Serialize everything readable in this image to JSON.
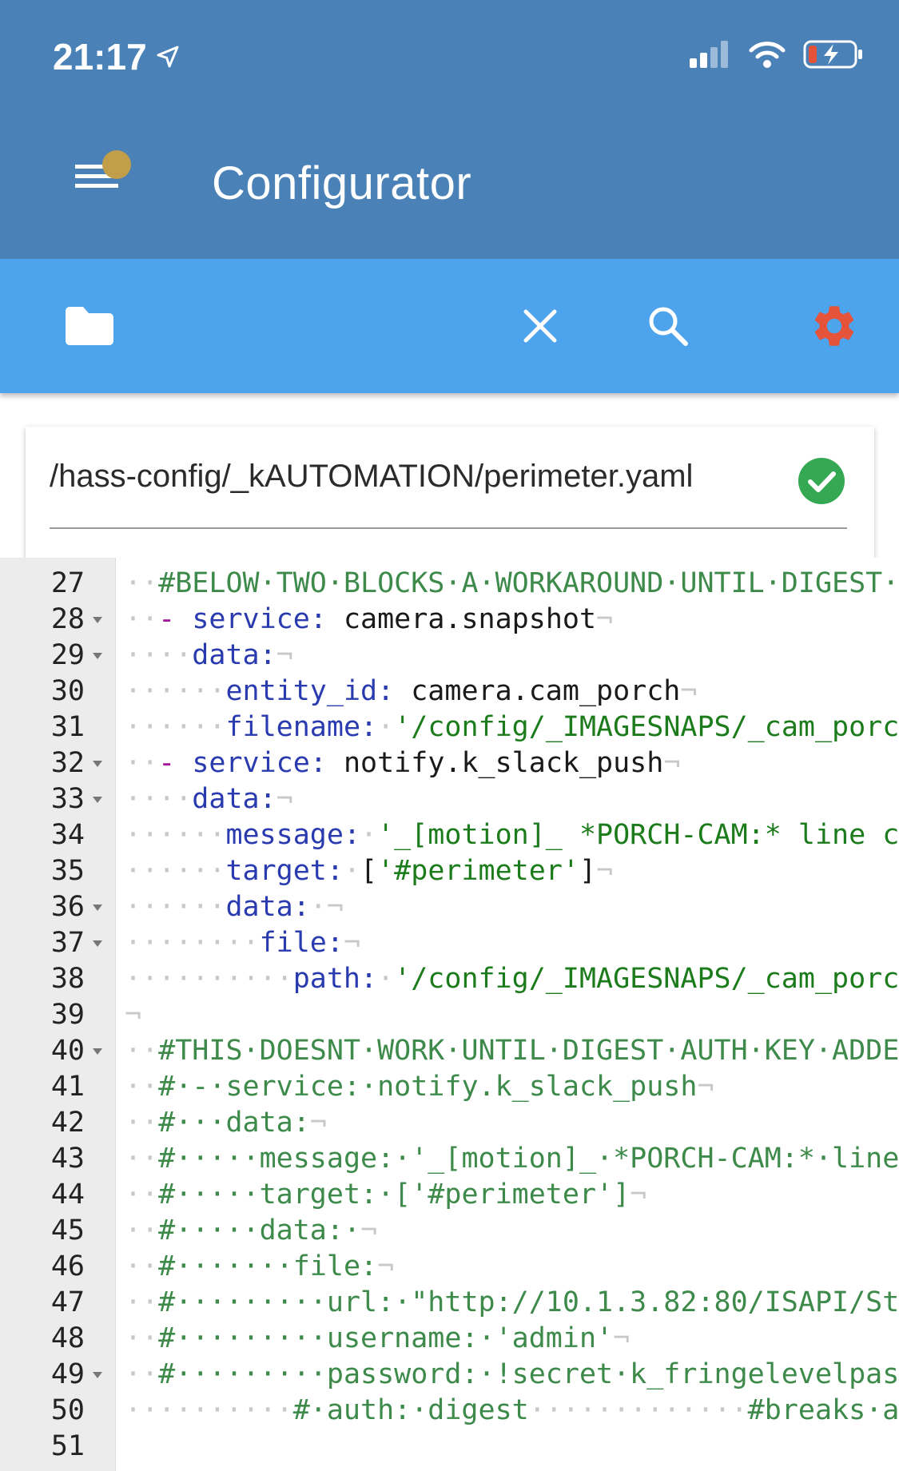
{
  "status_bar": {
    "time": "21:17"
  },
  "header": {
    "title": "Configurator"
  },
  "file": {
    "path": "/hass-config/_kAUTOMATION/perimeter.yaml"
  },
  "editor": {
    "lines": [
      {
        "n": "27",
        "fold": false,
        "segs": [
          {
            "c": "c-dot",
            "t": "··"
          },
          {
            "c": "c-comment",
            "t": "#BELOW·TWO·BLOCKS·A·WORKAROUND·UNTIL·DIGEST·"
          }
        ]
      },
      {
        "n": "28",
        "fold": true,
        "segs": [
          {
            "c": "c-dot",
            "t": "··"
          },
          {
            "c": "c-dash",
            "t": "-"
          },
          {
            "c": "c-plain",
            "t": " "
          },
          {
            "c": "c-key",
            "t": "service:"
          },
          {
            "c": "c-plain",
            "t": " camera.snapshot"
          },
          {
            "c": "c-dot",
            "t": "¬"
          }
        ]
      },
      {
        "n": "29",
        "fold": true,
        "segs": [
          {
            "c": "c-dot",
            "t": "····"
          },
          {
            "c": "c-key",
            "t": "data:"
          },
          {
            "c": "c-dot",
            "t": "¬"
          }
        ]
      },
      {
        "n": "30",
        "fold": false,
        "segs": [
          {
            "c": "c-dot",
            "t": "······"
          },
          {
            "c": "c-key",
            "t": "entity_id:"
          },
          {
            "c": "c-plain",
            "t": " camera.cam_porch"
          },
          {
            "c": "c-dot",
            "t": "¬"
          }
        ]
      },
      {
        "n": "31",
        "fold": false,
        "segs": [
          {
            "c": "c-dot",
            "t": "······"
          },
          {
            "c": "c-key",
            "t": "filename:"
          },
          {
            "c": "c-dot",
            "t": "·"
          },
          {
            "c": "c-str",
            "t": "'/config/_IMAGESNAPS/_cam_porc"
          }
        ]
      },
      {
        "n": "32",
        "fold": true,
        "segs": [
          {
            "c": "c-dot",
            "t": "··"
          },
          {
            "c": "c-dash",
            "t": "-"
          },
          {
            "c": "c-plain",
            "t": " "
          },
          {
            "c": "c-key",
            "t": "service:"
          },
          {
            "c": "c-plain",
            "t": " notify.k_slack_push"
          },
          {
            "c": "c-dot",
            "t": "¬"
          }
        ]
      },
      {
        "n": "33",
        "fold": true,
        "segs": [
          {
            "c": "c-dot",
            "t": "····"
          },
          {
            "c": "c-key",
            "t": "data:"
          },
          {
            "c": "c-dot",
            "t": "¬"
          }
        ]
      },
      {
        "n": "34",
        "fold": false,
        "segs": [
          {
            "c": "c-dot",
            "t": "······"
          },
          {
            "c": "c-key",
            "t": "message:"
          },
          {
            "c": "c-dot",
            "t": "·"
          },
          {
            "c": "c-str",
            "t": "'_[motion]_ *PORCH-CAM:* line c"
          }
        ]
      },
      {
        "n": "35",
        "fold": false,
        "segs": [
          {
            "c": "c-dot",
            "t": "······"
          },
          {
            "c": "c-key",
            "t": "target:"
          },
          {
            "c": "c-dot",
            "t": "·"
          },
          {
            "c": "c-plain",
            "t": "["
          },
          {
            "c": "c-str",
            "t": "'#perimeter'"
          },
          {
            "c": "c-plain",
            "t": "]"
          },
          {
            "c": "c-dot",
            "t": "¬"
          }
        ]
      },
      {
        "n": "36",
        "fold": true,
        "segs": [
          {
            "c": "c-dot",
            "t": "······"
          },
          {
            "c": "c-key",
            "t": "data:"
          },
          {
            "c": "c-dot",
            "t": "·¬"
          }
        ]
      },
      {
        "n": "37",
        "fold": true,
        "segs": [
          {
            "c": "c-dot",
            "t": "········"
          },
          {
            "c": "c-key",
            "t": "file:"
          },
          {
            "c": "c-dot",
            "t": "¬"
          }
        ]
      },
      {
        "n": "38",
        "fold": false,
        "segs": [
          {
            "c": "c-dot",
            "t": "··········"
          },
          {
            "c": "c-key",
            "t": "path:"
          },
          {
            "c": "c-dot",
            "t": "·"
          },
          {
            "c": "c-str",
            "t": "'/config/_IMAGESNAPS/_cam_porc"
          }
        ]
      },
      {
        "n": "39",
        "fold": false,
        "segs": [
          {
            "c": "c-dot",
            "t": "¬"
          }
        ]
      },
      {
        "n": "40",
        "fold": true,
        "segs": [
          {
            "c": "c-dot",
            "t": "··"
          },
          {
            "c": "c-comment",
            "t": "#THIS·DOESNT·WORK·UNTIL·DIGEST·AUTH·KEY·ADDE"
          }
        ]
      },
      {
        "n": "41",
        "fold": false,
        "segs": [
          {
            "c": "c-dot",
            "t": "··"
          },
          {
            "c": "c-comment",
            "t": "#·-·service:·notify.k_slack_push"
          },
          {
            "c": "c-dot",
            "t": "¬"
          }
        ]
      },
      {
        "n": "42",
        "fold": false,
        "segs": [
          {
            "c": "c-dot",
            "t": "··"
          },
          {
            "c": "c-comment",
            "t": "#···data:"
          },
          {
            "c": "c-dot",
            "t": "¬"
          }
        ]
      },
      {
        "n": "43",
        "fold": false,
        "segs": [
          {
            "c": "c-dot",
            "t": "··"
          },
          {
            "c": "c-comment",
            "t": "#·····message:·'_[motion]_·*PORCH-CAM:*·line"
          }
        ]
      },
      {
        "n": "44",
        "fold": false,
        "segs": [
          {
            "c": "c-dot",
            "t": "··"
          },
          {
            "c": "c-comment",
            "t": "#·····target:·['#perimeter']"
          },
          {
            "c": "c-dot",
            "t": "¬"
          }
        ]
      },
      {
        "n": "45",
        "fold": false,
        "segs": [
          {
            "c": "c-dot",
            "t": "··"
          },
          {
            "c": "c-comment",
            "t": "#·····data:·"
          },
          {
            "c": "c-dot",
            "t": "¬"
          }
        ]
      },
      {
        "n": "46",
        "fold": false,
        "segs": [
          {
            "c": "c-dot",
            "t": "··"
          },
          {
            "c": "c-comment",
            "t": "#·······file:"
          },
          {
            "c": "c-dot",
            "t": "¬"
          }
        ]
      },
      {
        "n": "47",
        "fold": false,
        "segs": [
          {
            "c": "c-dot",
            "t": "··"
          },
          {
            "c": "c-comment",
            "t": "#·········url:·\"http://10.1.3.82:80/ISAPI/St"
          }
        ]
      },
      {
        "n": "48",
        "fold": false,
        "segs": [
          {
            "c": "c-dot",
            "t": "··"
          },
          {
            "c": "c-comment",
            "t": "#·········username:·'admin'"
          },
          {
            "c": "c-dot",
            "t": "¬"
          }
        ]
      },
      {
        "n": "49",
        "fold": true,
        "segs": [
          {
            "c": "c-dot",
            "t": "··"
          },
          {
            "c": "c-comment",
            "t": "#·········password:·!secret·k_fringelevelpas"
          }
        ]
      },
      {
        "n": "50",
        "fold": false,
        "segs": [
          {
            "c": "c-dot",
            "t": "··········"
          },
          {
            "c": "c-comment",
            "t": "#·auth:·digest"
          },
          {
            "c": "c-dot",
            "t": "·············"
          },
          {
            "c": "c-comment",
            "t": "#breaks·af"
          }
        ]
      },
      {
        "n": "51",
        "fold": false,
        "segs": []
      }
    ]
  },
  "colors": {
    "header_bg": "#4a82b8",
    "toolbar_bg": "#4da4ec",
    "settings_icon": "#e5533b",
    "success_icon": "#34a853",
    "notification_dot": "#c29e4a"
  }
}
